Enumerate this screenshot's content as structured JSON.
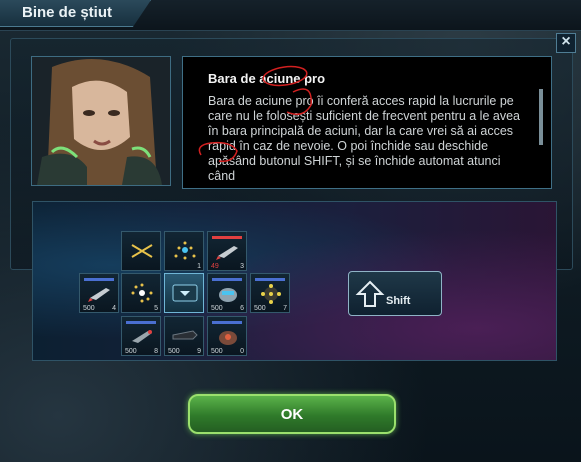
{
  "window": {
    "title": "Bine de știut"
  },
  "close_icon": "close-icon",
  "info": {
    "title": "Bara de aciune pro",
    "body": "Bara de aciune pro îi conferă acces rapid la lucrurile pe care nu le folosești suficient de frecvent pentru a le avea în bara principală de aciuni, dar la care vrei să ai acces rapid în caz de nevoie. O poi închide sau deschide apăsând butonul SHIFT, și se închide automat atunci când"
  },
  "slots": [
    {
      "num": "",
      "qty": ""
    },
    {
      "num": "1",
      "qty": ""
    },
    {
      "num": "",
      "qty": ""
    },
    {
      "num": "3",
      "qty": "49"
    },
    {
      "num": "4",
      "qty": "500"
    },
    {
      "num": "5",
      "qty": ""
    },
    {
      "num": "",
      "qty": ""
    },
    {
      "num": "6",
      "qty": "500"
    },
    {
      "num": "7",
      "qty": "500"
    },
    {
      "num": "8",
      "qty": "500"
    },
    {
      "num": "9",
      "qty": "500"
    },
    {
      "num": "0",
      "qty": "500"
    }
  ],
  "shift_button": {
    "label": "Shift",
    "icon": "arrow-up-icon"
  },
  "ok_button": {
    "label": "OK"
  },
  "colors": {
    "accent": "#4b7a90",
    "ok_green": "#5bb34a",
    "annotation_red": "#d22020"
  }
}
